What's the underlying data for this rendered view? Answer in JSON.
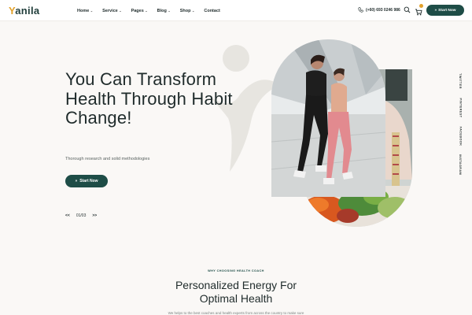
{
  "header": {
    "logo_text": "anila",
    "nav": [
      {
        "label": "Home",
        "has_dropdown": true
      },
      {
        "label": "Service",
        "has_dropdown": true
      },
      {
        "label": "Pages",
        "has_dropdown": true
      },
      {
        "label": "Blog",
        "has_dropdown": true
      },
      {
        "label": "Shop",
        "has_dropdown": true
      },
      {
        "label": "Contact",
        "has_dropdown": false
      }
    ],
    "phone": "(+60) 693 0246 986",
    "cta_label": "Start Now"
  },
  "hero": {
    "title": "You Can Transform Health Through Habit Change!",
    "subtitle": "Thorough research and solid methodologies",
    "cta_label": "Start Now",
    "slider": {
      "prev": "<<",
      "counter": "01/03",
      "next": ">>"
    }
  },
  "social": [
    "TWITTER",
    "PINTEREST",
    "FACEBOOK",
    "INSTAGRAM"
  ],
  "section": {
    "kicker": "WHY CHOOSING HEALTH COACH",
    "title_line1": "Personalized Energy For",
    "title_line2": "Optimal Health",
    "text": "We helps to the best coaches and health experts from across the country to make sure"
  },
  "colors": {
    "primary": "#1e4d47",
    "accent": "#e2a12b",
    "background": "#faf8f6",
    "text": "#1f2b2b"
  }
}
